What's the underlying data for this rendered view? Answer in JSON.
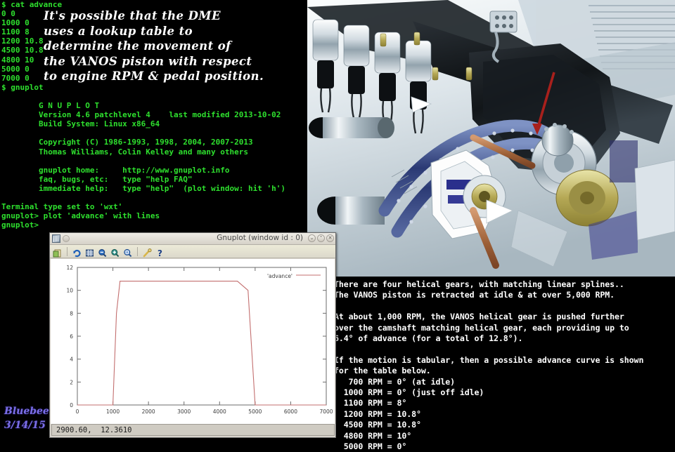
{
  "terminal": {
    "lines": [
      "$ cat advance",
      "0 0",
      "1000 0",
      "1100 8",
      "1200 10.8",
      "4500 10.8",
      "4800 10",
      "5000 0",
      "7000 0",
      "$ gnuplot",
      "",
      "        G N U P L O T",
      "        Version 4.6 patchlevel 4    last modified 2013-10-02",
      "        Build System: Linux x86_64",
      "",
      "        Copyright (C) 1986-1993, 1998, 2004, 2007-2013",
      "        Thomas Williams, Colin Kelley and many others",
      "",
      "        gnuplot home:     http://www.gnuplot.info",
      "        faq, bugs, etc:   type \"help FAQ\"",
      "        immediate help:   type \"help\"  (plot window: hit 'h')",
      "",
      "Terminal type set to 'wxt'",
      "gnuplot> plot 'advance' with lines",
      "gnuplot> "
    ]
  },
  "annotation": {
    "lines": [
      "It's possible that the DME",
      "uses a lookup table to",
      "determine the movement of",
      "the VANOS piston with respect",
      "to engine RPM & pedal position."
    ]
  },
  "description": {
    "lines": [
      "There are four helical gears, with matching linear splines..",
      "The VANOS piston is retracted at idle & at over 5,000 RPM.",
      "",
      "At about 1,000 RPM, the VANOS helical gear is pushed further",
      "over the camshaft matching helical gear, each providing up to",
      "6.4° of advance (for a total of 12.8°).",
      "",
      "If the motion is tabular, then a possible advance curve is shown",
      "for the table below.",
      "   700 RPM = 0° (at idle)",
      "  1000 RPM = 0° (just off idle)",
      "  1100 RPM = 8°",
      "  1200 RPM = 10.8°",
      "  4500 RPM = 10.8°",
      "  4800 RPM = 10°",
      "  5000 RPM = 0°"
    ]
  },
  "gnuplot_window": {
    "title": "Gnuplot (window id : 0)",
    "minimize_label": "⌄",
    "maximize_label": "⌃",
    "close_label": "✕",
    "toolbar": [
      {
        "name": "copy-to-clipboard-icon",
        "tip": "Copy to clipboard"
      },
      {
        "name": "replot-icon",
        "tip": "Replot"
      },
      {
        "name": "toggle-grid-icon",
        "tip": "Toggle grid"
      },
      {
        "name": "zoom-previous-icon",
        "tip": "Previous zoom"
      },
      {
        "name": "zoom-next-icon",
        "tip": "Next zoom"
      },
      {
        "name": "autoscale-icon",
        "tip": "Autoscale"
      },
      {
        "name": "settings-icon",
        "tip": "Settings"
      },
      {
        "name": "help-icon",
        "tip": "?"
      }
    ],
    "statusbar": "2900.60,  12.3610"
  },
  "chart_data": {
    "type": "line",
    "title": "",
    "xlabel": "",
    "ylabel": "",
    "xlim": [
      0,
      7000
    ],
    "ylim": [
      0,
      12
    ],
    "xticks": [
      0,
      1000,
      2000,
      3000,
      4000,
      5000,
      6000,
      7000
    ],
    "yticks": [
      0,
      2,
      4,
      6,
      8,
      10,
      12
    ],
    "grid": false,
    "legend_position": "top-right",
    "series": [
      {
        "name": "'advance'",
        "color": "#c36f6f",
        "x": [
          0,
          1000,
          1100,
          1200,
          4500,
          4800,
          5000,
          7000
        ],
        "y": [
          0,
          0,
          8,
          10.8,
          10.8,
          10,
          0,
          0
        ]
      }
    ]
  },
  "watermark": {
    "name": "Bluebee",
    "date": "3/14/15"
  },
  "colors": {
    "terminal_green": "#2ee02e",
    "annotation_white": "#ffffff",
    "plot_line": "#c36f6f",
    "watermark_purple": "#7b6fe8",
    "arrow_red": "#a8201c"
  }
}
